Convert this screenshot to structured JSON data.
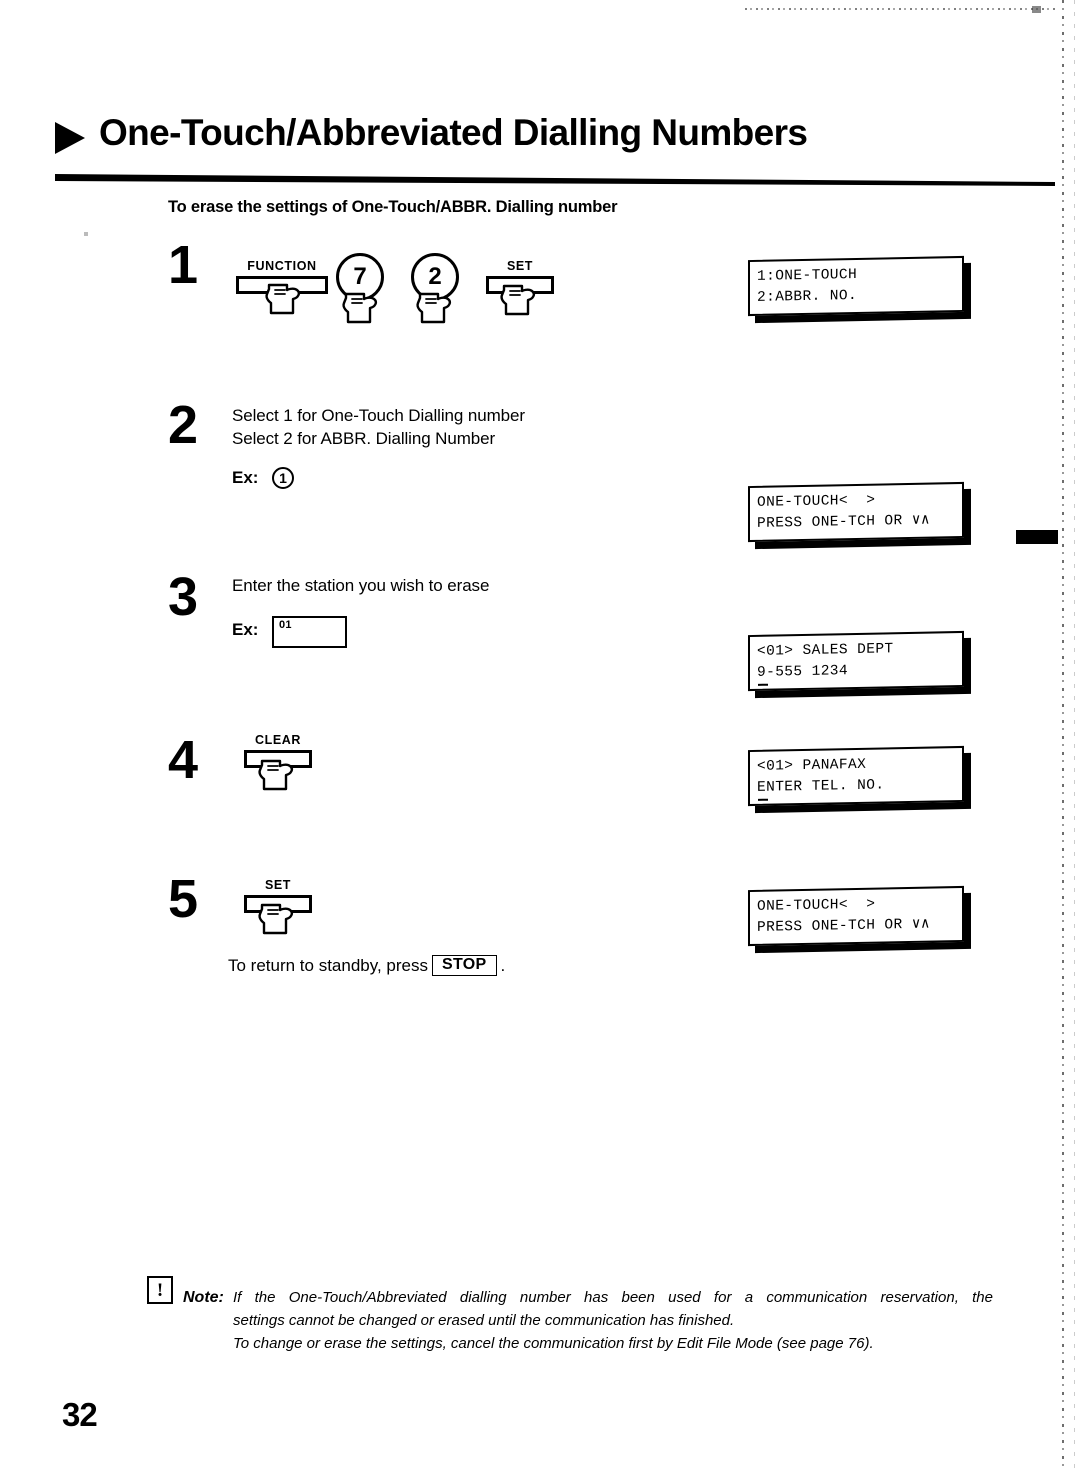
{
  "document": {
    "header": {
      "arrow_icon": "triangle-right-icon",
      "title": "One-Touch/Abbreviated Dialling Numbers"
    },
    "subtitle": "To erase the settings of One-Touch/ABBR. Dialling number",
    "page_number": "32"
  },
  "steps": [
    {
      "number": "1",
      "text": "",
      "keys": [
        {
          "type": "bar",
          "label": "FUNCTION"
        },
        {
          "type": "circle",
          "label": "7"
        },
        {
          "type": "circle",
          "label": "2"
        },
        {
          "type": "bar",
          "label": "SET"
        }
      ],
      "display": {
        "line1": "1:ONE-TOUCH",
        "line2": "2:ABBR. NO.",
        "cursor": false
      }
    },
    {
      "number": "2",
      "text": "Select 1 for One-Touch Dialling number\nSelect 2 for ABBR. Dialling Number",
      "example_label": "Ex:",
      "example_value": "1",
      "display": {
        "line1": "ONE-TOUCH<  >",
        "line2": "PRESS ONE-TCH OR ∨∧",
        "cursor": false
      }
    },
    {
      "number": "3",
      "text": "Enter the station you wish to erase",
      "example_label": "Ex:",
      "station_key_label": "01",
      "display": {
        "line1": "<01> SALES DEPT",
        "line2": "9-555 1234",
        "cursor": true
      }
    },
    {
      "number": "4",
      "text": "",
      "keys": [
        {
          "type": "bar",
          "label": "CLEAR"
        }
      ],
      "display": {
        "line1": "<01> PANAFAX",
        "line2": "ENTER TEL. NO.",
        "cursor": true
      }
    },
    {
      "number": "5",
      "text": "",
      "keys": [
        {
          "type": "bar",
          "label": "SET"
        }
      ],
      "standby_prefix": "To return to standby, press",
      "standby_key": "STOP",
      "standby_suffix": ".",
      "display": {
        "line1": "ONE-TOUCH<  >",
        "line2": "PRESS ONE-TCH OR ∨∧",
        "cursor": false
      }
    }
  ],
  "note": {
    "icon": "warning-exclamation-icon",
    "exclamation": "!",
    "label": "Note:",
    "line1": "If the One-Touch/Abbreviated dialling number has been used for a communication reservation, the",
    "line2": "settings cannot be changed or erased until the communication has finished.",
    "line3": "To change or erase the settings, cancel the communication first by Edit File Mode (see page 76)."
  }
}
